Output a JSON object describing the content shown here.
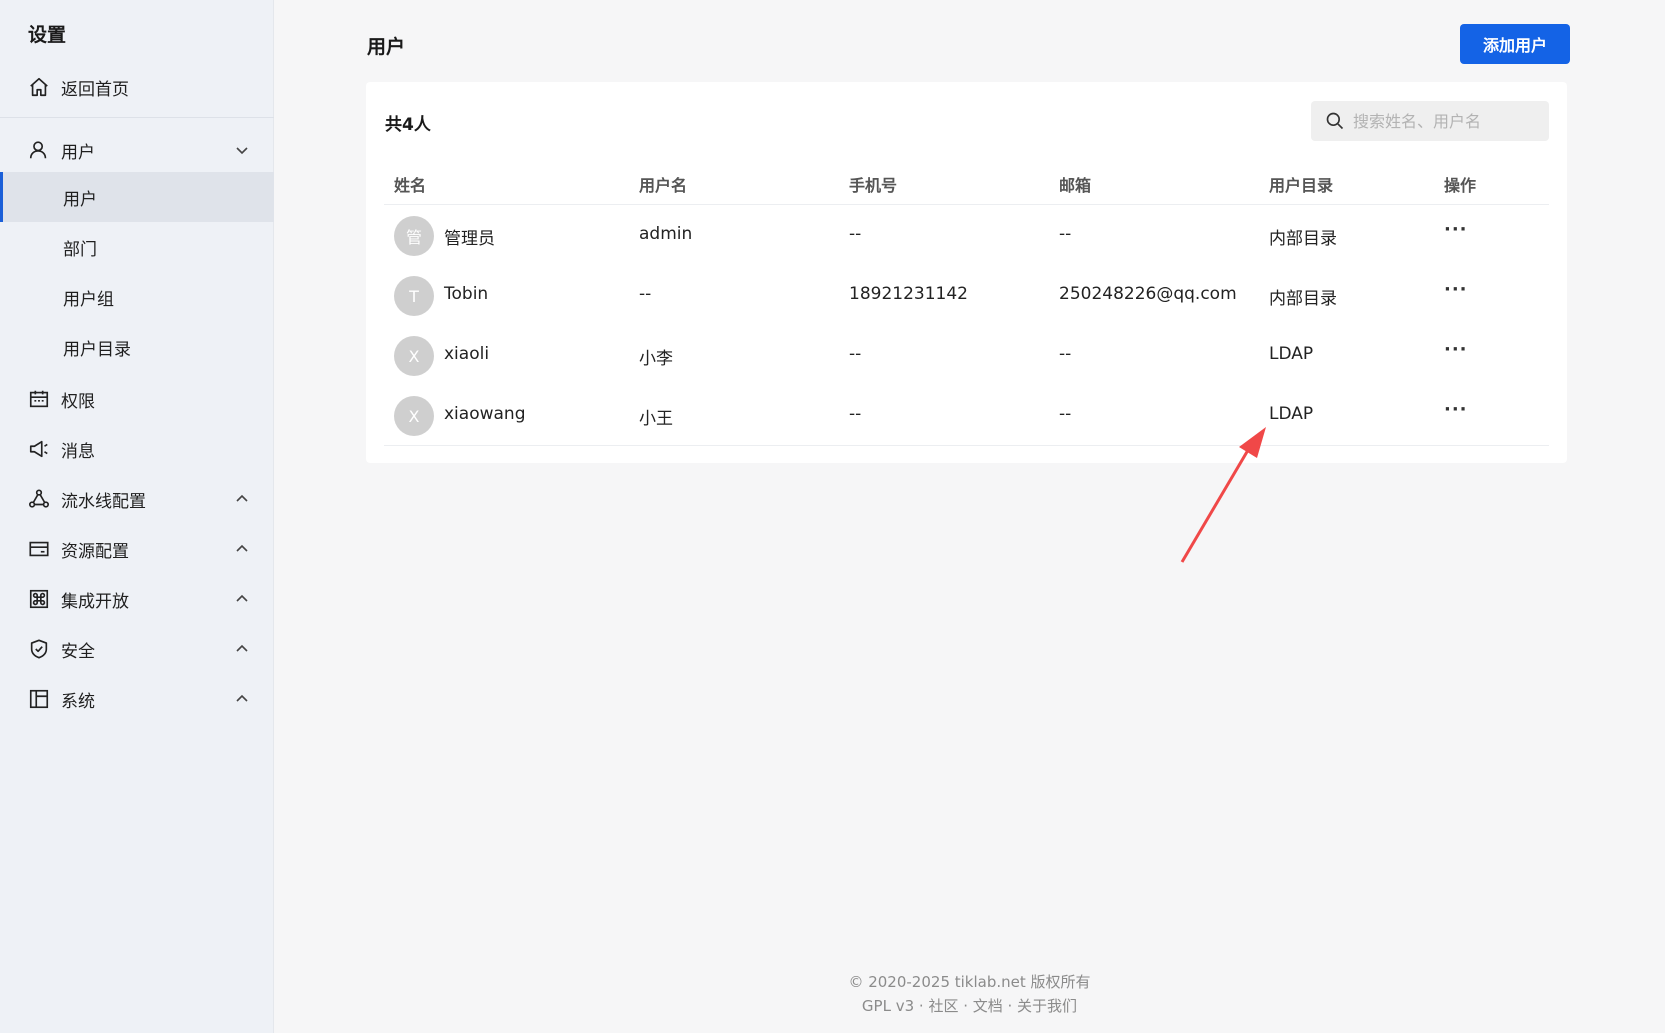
{
  "sidebar": {
    "title": "设置",
    "home": "返回首页",
    "user_group": "用户",
    "sub_items": [
      "用户",
      "部门",
      "用户组",
      "用户目录"
    ],
    "items": [
      "权限",
      "消息",
      "流水线配置",
      "资源配置",
      "集成开放",
      "安全",
      "系统"
    ]
  },
  "header": {
    "title": "用户",
    "add_button": "添加用户"
  },
  "card": {
    "count": "共4人",
    "search_placeholder": "搜索姓名、用户名"
  },
  "table": {
    "columns": [
      "姓名",
      "用户名",
      "手机号",
      "邮箱",
      "用户目录",
      "操作"
    ],
    "rows": [
      {
        "avatar": "管",
        "name": "管理员",
        "username": "admin",
        "phone": "--",
        "email": "--",
        "directory": "内部目录"
      },
      {
        "avatar": "T",
        "name": "Tobin",
        "username": "--",
        "phone": "18921231142",
        "email": "250248226@qq.com",
        "directory": "内部目录"
      },
      {
        "avatar": "X",
        "name": "xiaoli",
        "username": "小李",
        "phone": "--",
        "email": "--",
        "directory": "LDAP"
      },
      {
        "avatar": "X",
        "name": "xiaowang",
        "username": "小王",
        "phone": "--",
        "email": "--",
        "directory": "LDAP"
      }
    ],
    "more_label": "···"
  },
  "footer": {
    "line1": "© 2020-2025 tiklab.net 版权所有",
    "line2": "GPL v3 · 社区 · 文档 · 关于我们"
  },
  "colors": {
    "accent": "#1463e6",
    "annotation": "#f04848"
  }
}
